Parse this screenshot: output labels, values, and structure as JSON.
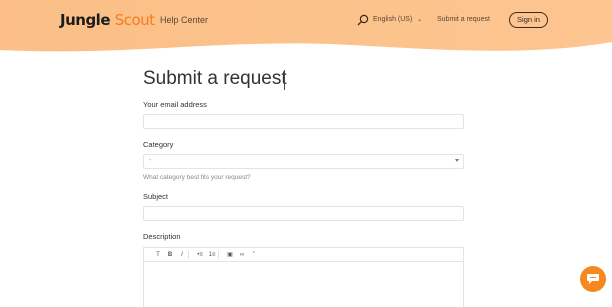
{
  "header": {
    "logo_word1": "Jungle",
    "logo_word2": "Scout",
    "help_center": "Help Center",
    "language": "English (US)",
    "submit_request_link": "Submit a request",
    "sign_in": "Sign in",
    "background_color": "#fcc189",
    "brand_color": "#f57d21"
  },
  "form": {
    "title": "Submit a request",
    "email_label": "Your email address",
    "category_label": "Category",
    "category_value": "-",
    "category_hint": "What category best fits your request?",
    "subject_label": "Subject",
    "description_label": "Description",
    "toolbar": {
      "text_style": "T",
      "bold": "B",
      "italic": "I",
      "bulleted_list": "•≡",
      "numbered_list": "1≡",
      "image": "▣",
      "link": "∞",
      "quote": "”"
    }
  },
  "icons": [
    "search-icon",
    "chevron-down-icon",
    "chat-icon"
  ],
  "chat_button_color": "#f5891f"
}
